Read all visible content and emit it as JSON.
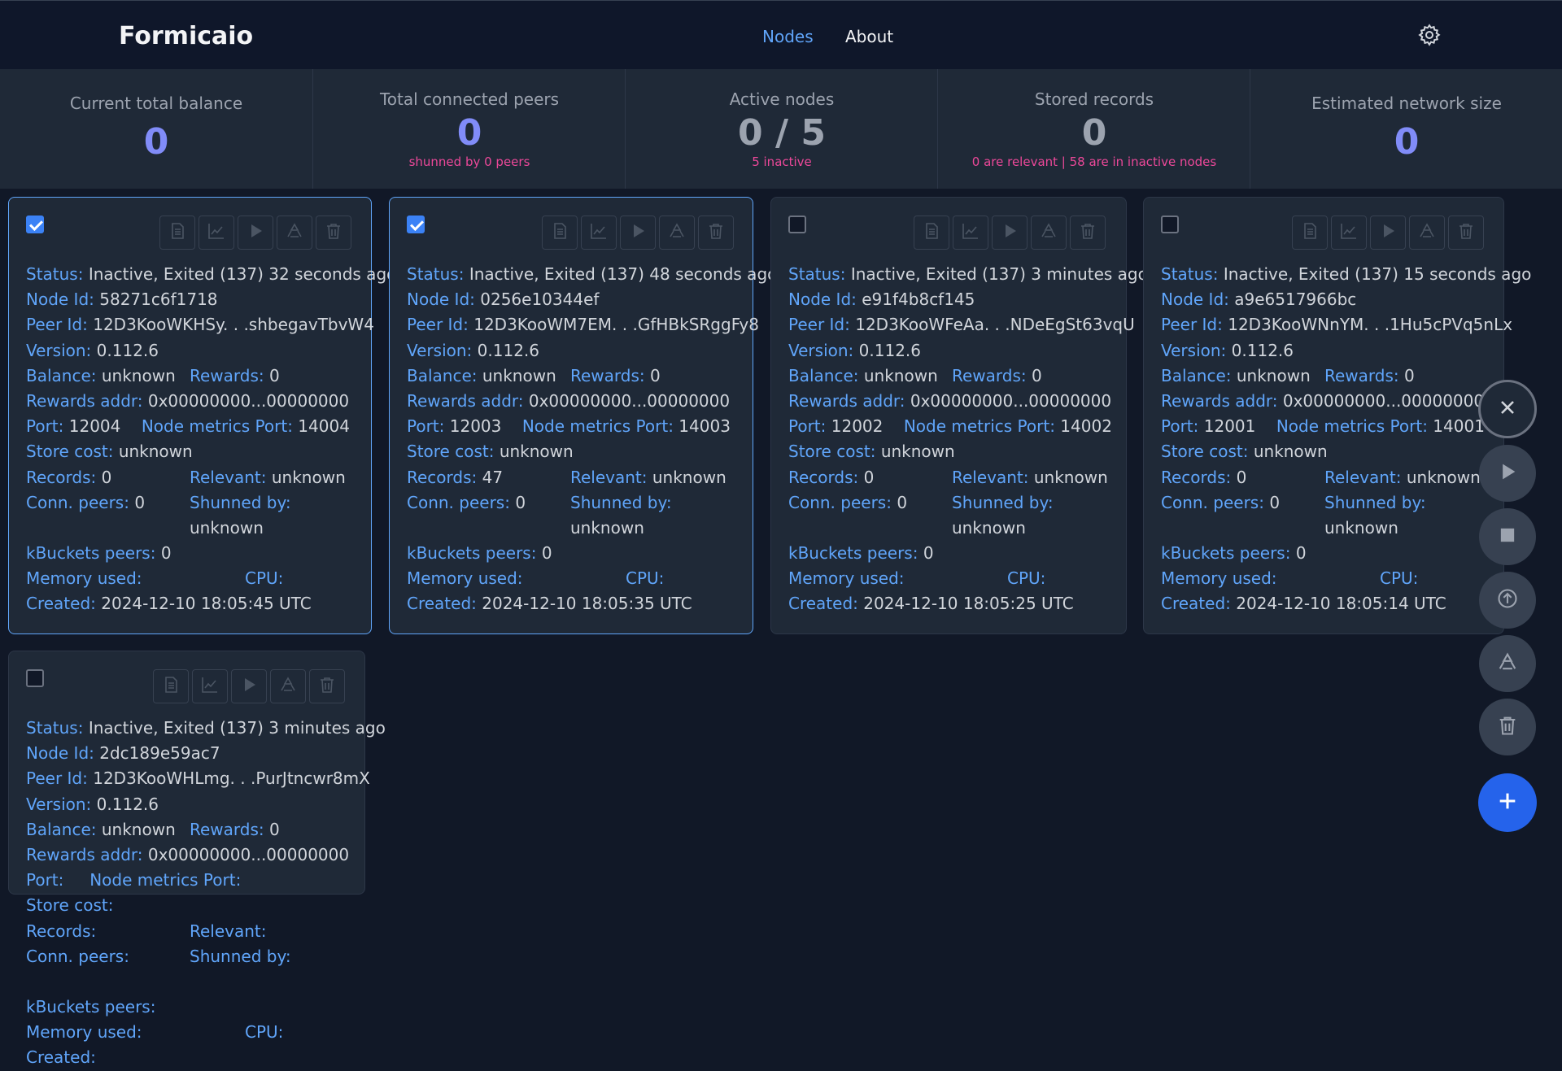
{
  "app": {
    "title": "Formicaio"
  },
  "nav": {
    "nodes": "Nodes",
    "about": "About"
  },
  "stats": {
    "balance": {
      "title": "Current total balance",
      "value": "0"
    },
    "peers": {
      "title": "Total connected peers",
      "value": "0",
      "sub": "shunned by 0 peers"
    },
    "active": {
      "title": "Active nodes",
      "value": "0 / 5",
      "sub": "5 inactive"
    },
    "records": {
      "title": "Stored records",
      "value": "0",
      "sub": "0 are relevant | 58 are in inactive nodes"
    },
    "network": {
      "title": "Estimated network size",
      "value": "0"
    }
  },
  "labels": {
    "status": "Status:",
    "node_id": "Node Id:",
    "peer_id": "Peer Id:",
    "version": "Version:",
    "balance": "Balance:",
    "rewards": "Rewards:",
    "rewards_addr": "Rewards addr:",
    "port": "Port:",
    "metrics_port": "Node metrics Port:",
    "store_cost": "Store cost:",
    "records": "Records:",
    "relevant": "Relevant:",
    "conn_peers": "Conn. peers:",
    "shunned": "Shunned by:",
    "kbuckets": "kBuckets peers:",
    "memory": "Memory used:",
    "cpu": "CPU:",
    "created": "Created:"
  },
  "nodes": [
    {
      "checked": true,
      "status": "Inactive, Exited (137) 32 seconds ago",
      "node_id": "58271c6f1718",
      "peer_id": "12D3KooWKHSy. . .shbegavTbvW4",
      "version": "0.112.6",
      "balance": "unknown",
      "rewards": "0",
      "rewards_addr": "0x00000000...00000000",
      "port": "12004",
      "metrics_port": "14004",
      "store_cost": "unknown",
      "records": "0",
      "relevant": "unknown",
      "conn_peers": "0",
      "shunned": "unknown",
      "kbuckets": "0",
      "memory": "",
      "cpu": "",
      "created": "2024-12-10 18:05:45 UTC"
    },
    {
      "checked": true,
      "status": "Inactive, Exited (137) 48 seconds ago",
      "node_id": "0256e10344ef",
      "peer_id": "12D3KooWM7EM. . .GfHBkSRggFy8",
      "version": "0.112.6",
      "balance": "unknown",
      "rewards": "0",
      "rewards_addr": "0x00000000...00000000",
      "port": "12003",
      "metrics_port": "14003",
      "store_cost": "unknown",
      "records": "47",
      "relevant": "unknown",
      "conn_peers": "0",
      "shunned": "unknown",
      "kbuckets": "0",
      "memory": "",
      "cpu": "",
      "created": "2024-12-10 18:05:35 UTC"
    },
    {
      "checked": false,
      "status": "Inactive, Exited (137) 3 minutes ago",
      "node_id": "e91f4b8cf145",
      "peer_id": "12D3KooWFeAa. . .NDeEgSt63vqU",
      "version": "0.112.6",
      "balance": "unknown",
      "rewards": "0",
      "rewards_addr": "0x00000000...00000000",
      "port": "12002",
      "metrics_port": "14002",
      "store_cost": "unknown",
      "records": "0",
      "relevant": "unknown",
      "conn_peers": "0",
      "shunned": "unknown",
      "kbuckets": "0",
      "memory": "",
      "cpu": "",
      "created": "2024-12-10 18:05:25 UTC"
    },
    {
      "checked": false,
      "status": "Inactive, Exited (137) 15 seconds ago",
      "node_id": "a9e6517966bc",
      "peer_id": "12D3KooWNnYM. . .1Hu5cPVq5nLx",
      "version": "0.112.6",
      "balance": "unknown",
      "rewards": "0",
      "rewards_addr": "0x00000000...00000000",
      "port": "12001",
      "metrics_port": "14001",
      "store_cost": "unknown",
      "records": "0",
      "relevant": "unknown",
      "conn_peers": "0",
      "shunned": "unknown",
      "kbuckets": "0",
      "memory": "",
      "cpu": "",
      "created": "2024-12-10 18:05:14 UTC"
    },
    {
      "checked": false,
      "status": "Inactive, Exited (137) 3 minutes ago",
      "node_id": "2dc189e59ac7",
      "peer_id": "12D3KooWHLmg. . .PurJtncwr8mX",
      "version": "0.112.6",
      "balance": "unknown",
      "rewards": "0",
      "rewards_addr": "0x00000000...00000000",
      "port": "",
      "metrics_port": "",
      "store_cost": "",
      "records": "",
      "relevant": "",
      "conn_peers": "",
      "shunned": "",
      "kbuckets": "",
      "memory": "",
      "cpu": "",
      "created": ""
    }
  ],
  "icons": {
    "settings": "gear-icon",
    "logs": "document-icon",
    "metrics": "chart-icon",
    "start": "play-icon",
    "upgrade": "recycle-icon",
    "remove": "trash-icon",
    "close": "close-icon",
    "stop": "stop-icon",
    "upgrade_all": "arrow-up-circle-icon",
    "add": "plus-icon"
  },
  "colors": {
    "accent": "#60a5fa",
    "stat_value": "#818cf8",
    "warning_text": "#ec4899",
    "primary_button": "#2563eb",
    "background": "#111827",
    "card": "#1f2937"
  }
}
